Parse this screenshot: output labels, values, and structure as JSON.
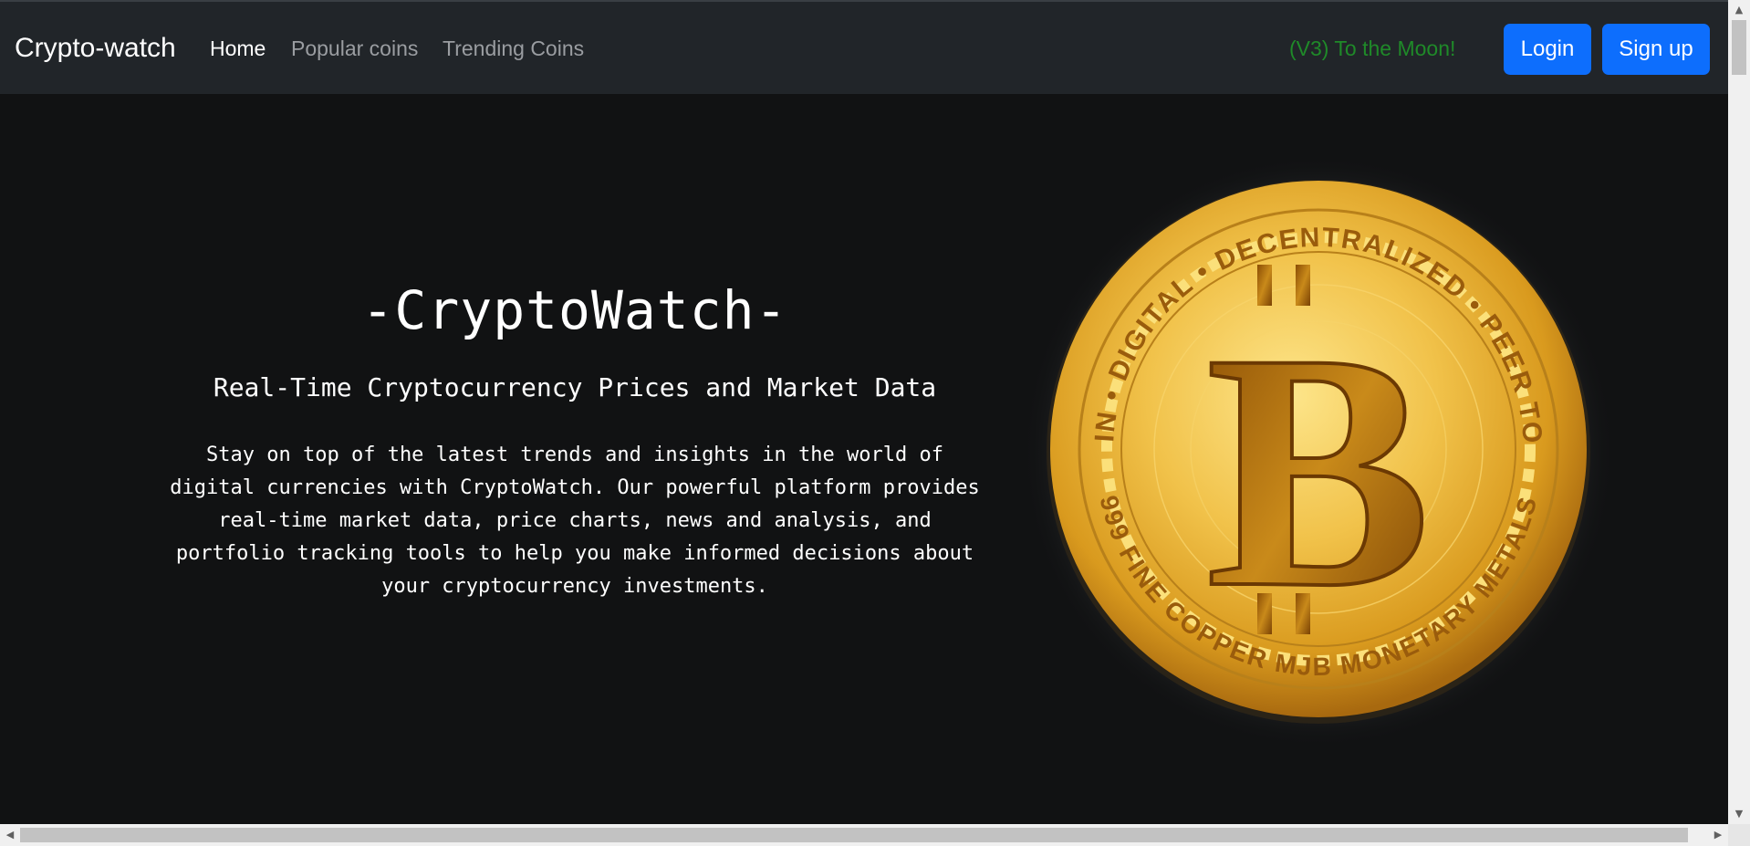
{
  "navbar": {
    "brand": "Crypto-watch",
    "links": [
      {
        "label": "Home"
      },
      {
        "label": "Popular coins"
      },
      {
        "label": "Trending Coins"
      }
    ],
    "tagline": "(V3) To the Moon!",
    "login_label": "Login",
    "signup_label": "Sign up"
  },
  "hero": {
    "title": "-CryptoWatch-",
    "subtitle": "Real-Time Cryptocurrency Prices and Market Data",
    "description": "Stay on top of the latest trends and insights in the world of digital currencies with CryptoWatch. Our powerful platform provides real-time market data, price charts, news and analysis, and portfolio tracking tools to help you make informed decisions about your cryptocurrency investments."
  },
  "coin": {
    "upper_text": "BITCOIN • DIGITAL • DECENTRALIZED • PEER TO PEER",
    "lower_text": "999 FINE COPPER MJB MONETARY METALS",
    "symbol": "B",
    "gold": "#e8b12e"
  },
  "colors": {
    "navbar_bg": "#212529",
    "primary_button": "#0d6efd",
    "tagline_green": "#1f8a29",
    "page_bg": "#111213"
  }
}
